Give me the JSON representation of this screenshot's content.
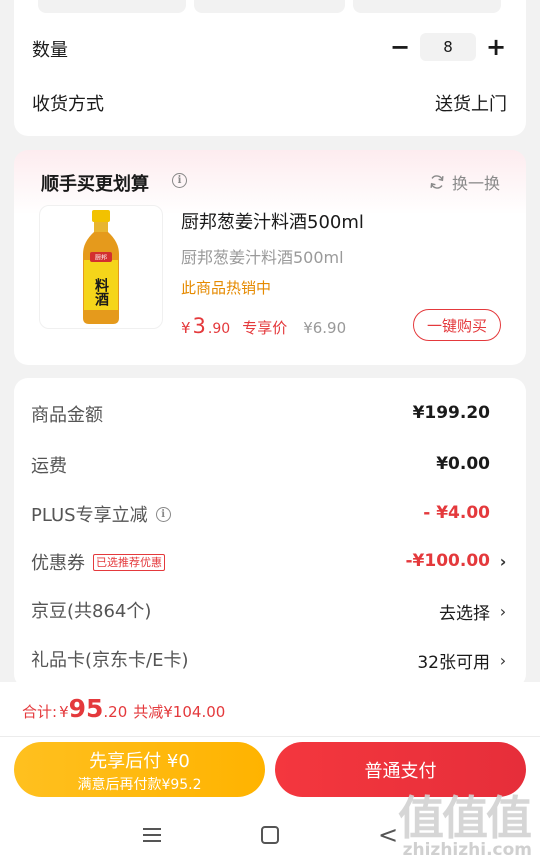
{
  "order": {
    "quantity_label": "数量",
    "minus_symbol": "−",
    "quantity_value": "8",
    "plus_symbol": "+",
    "delivery_label": "收货方式",
    "delivery_value": "送货上门"
  },
  "recommend": {
    "title": "顺手买更划算",
    "info_symbol": "i",
    "swap_label": "换一换",
    "product": {
      "name": "厨邦葱姜汁料酒500ml",
      "subtitle": "厨邦葱姜汁料酒500ml",
      "hot_label": "此商品热销中",
      "price_yen": "¥",
      "price_int": "3",
      "price_dec": ".90",
      "price_tag": "专享价",
      "original_price": "¥6.90",
      "buy_label": "一键购买",
      "bottle_label": "料酒",
      "bottle_brand": "厨邦"
    }
  },
  "summary": {
    "rows": [
      {
        "label": "商品金额",
        "value": "¥199.20"
      },
      {
        "label": "运费",
        "value": "¥0.00"
      },
      {
        "label": "PLUS专享立减",
        "value": "- ¥4.00",
        "info_symbol": "i"
      },
      {
        "label": "优惠券",
        "badge": "已选推荐优惠",
        "value": "-¥100.00"
      },
      {
        "label": "京豆(共864个)",
        "value": "去选择"
      },
      {
        "label": "礼品卡(京东卡/E卡)",
        "value": "32张可用"
      }
    ],
    "chevron": "›"
  },
  "footer": {
    "total_label": "合计:",
    "total_yen": "¥",
    "total_int": "95",
    "total_dec": ".20",
    "saved_label": "共减¥104.00",
    "pay_later_main": "先享后付 ¥0",
    "pay_later_sub": "满意后再付款¥95.2",
    "pay_label": "普通支付",
    "nav_back": "<"
  },
  "watermark": {
    "logo": "值值值",
    "url": "zhizhizhi.com"
  },
  "colors": {
    "accent_red": "#e4393c",
    "orange_hot": "#e58a00",
    "pay_later_yellow": "#ffb300",
    "page_bg": "#f2f2f2"
  }
}
